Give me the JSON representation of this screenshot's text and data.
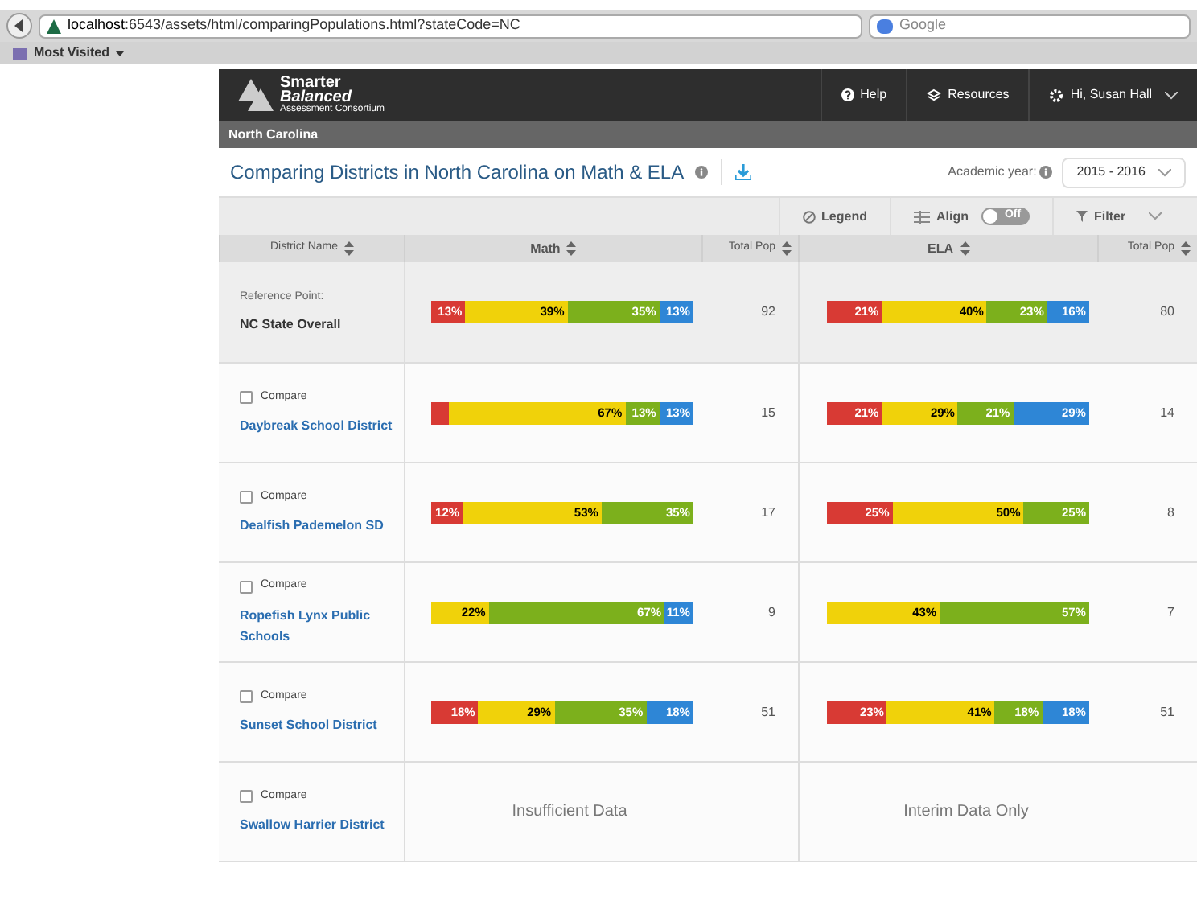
{
  "browser": {
    "url_host": "localhost",
    "url_rest": ":6543/assets/html/comparingPopulations.html?stateCode=NC",
    "search_placeholder": "Google",
    "bookmark": "Most Visited"
  },
  "header": {
    "logo_line1": "Smarter",
    "logo_line2": "Balanced",
    "logo_line3": "Assessment Consortium",
    "help": "Help",
    "resources": "Resources",
    "user": "Hi, Susan Hall"
  },
  "breadcrumb": "North Carolina",
  "title": "Comparing Districts in North Carolina on Math & ELA",
  "academic_year": {
    "label": "Academic year:",
    "value": "2015 - 2016"
  },
  "toolbar": {
    "legend": "Legend",
    "align": "Align",
    "align_toggle": {
      "label": "Off",
      "on": false
    },
    "filter": "Filter"
  },
  "table": {
    "columns": [
      "District Name",
      "Math",
      "Total Pop",
      "ELA",
      "Total Pop"
    ],
    "rows": [
      {
        "kind": "reference",
        "caption": "Reference Point:",
        "name": "NC State Overall",
        "math": {
          "segments": [
            {
              "label": "13%",
              "color": "#d83a34"
            },
            {
              "label": "39%",
              "color": "#f0d20a"
            },
            {
              "label": "35%",
              "color": "#7cb01c"
            },
            {
              "label": "13%",
              "color": "#2e86d6"
            }
          ]
        },
        "math_pop": "92",
        "ela": {
          "segments": [
            {
              "label": "21%",
              "color": "#d83a34"
            },
            {
              "label": "40%",
              "color": "#f0d20a"
            },
            {
              "label": "23%",
              "color": "#7cb01c"
            },
            {
              "label": "16%",
              "color": "#2e86d6"
            }
          ]
        },
        "ela_pop": "80"
      },
      {
        "kind": "district",
        "compare": "Compare",
        "checked": false,
        "name": "Daybreak School District",
        "math": {
          "segments": [
            {
              "color": "#d83a34"
            },
            {
              "label": "67%",
              "color": "#f0d20a"
            },
            {
              "label": "13%",
              "color": "#7cb01c"
            },
            {
              "label": "13%",
              "color": "#2e86d6"
            }
          ]
        },
        "math_pop": "15",
        "ela": {
          "segments": [
            {
              "label": "21%",
              "color": "#d83a34"
            },
            {
              "label": "29%",
              "color": "#f0d20a"
            },
            {
              "label": "21%",
              "color": "#7cb01c"
            },
            {
              "label": "29%",
              "color": "#2e86d6"
            }
          ]
        },
        "ela_pop": "14"
      },
      {
        "kind": "district",
        "compare": "Compare",
        "checked": false,
        "name": "Dealfish Pademelon SD",
        "math": {
          "segments": [
            {
              "label": "12%",
              "color": "#d83a34"
            },
            {
              "label": "53%",
              "color": "#f0d20a"
            },
            {
              "label": "35%",
              "color": "#7cb01c"
            }
          ]
        },
        "math_pop": "17",
        "ela": {
          "segments": [
            {
              "label": "25%",
              "color": "#d83a34"
            },
            {
              "label": "50%",
              "color": "#f0d20a"
            },
            {
              "label": "25%",
              "color": "#7cb01c"
            }
          ]
        },
        "ela_pop": "8"
      },
      {
        "kind": "district",
        "compare": "Compare",
        "checked": false,
        "name": "Ropefish Lynx Public Schools",
        "math": {
          "segments": [
            {
              "label": "22%",
              "color": "#f0d20a"
            },
            {
              "label": "67%",
              "color": "#7cb01c"
            },
            {
              "label": "11%",
              "color": "#2e86d6"
            }
          ]
        },
        "math_pop": "9",
        "ela": {
          "segments": [
            {
              "label": "43%",
              "color": "#f0d20a"
            },
            {
              "label": "57%",
              "color": "#7cb01c"
            }
          ]
        },
        "ela_pop": "7"
      },
      {
        "kind": "district",
        "compare": "Compare",
        "checked": false,
        "name": "Sunset School District",
        "math": {
          "segments": [
            {
              "label": "18%",
              "color": "#d83a34"
            },
            {
              "label": "29%",
              "color": "#f0d20a"
            },
            {
              "label": "35%",
              "color": "#7cb01c"
            },
            {
              "label": "18%",
              "color": "#2e86d6"
            }
          ]
        },
        "math_pop": "51",
        "ela": {
          "segments": [
            {
              "label": "23%",
              "color": "#d83a34"
            },
            {
              "label": "41%",
              "color": "#f0d20a"
            },
            {
              "label": "18%",
              "color": "#7cb01c"
            },
            {
              "label": "18%",
              "color": "#2e86d6"
            }
          ]
        },
        "ela_pop": "51"
      },
      {
        "kind": "district",
        "compare": "Compare",
        "checked": false,
        "name": "Swallow Harrier District",
        "math": {
          "message": "Insufficient Data"
        },
        "ela": {
          "message": "Interim Data Only"
        }
      }
    ]
  }
}
